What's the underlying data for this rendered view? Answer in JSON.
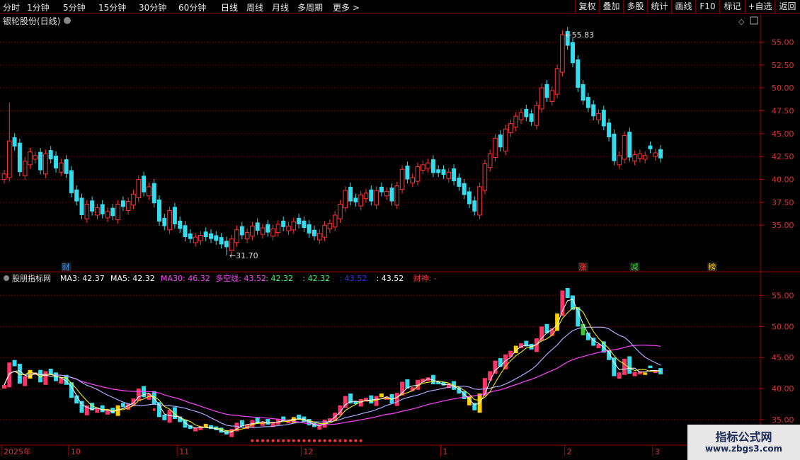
{
  "toolbar": {
    "periods": [
      "分时",
      "1分钟",
      "5分钟",
      "15分钟",
      "30分钟",
      "60分钟",
      "日线",
      "周线",
      "月线",
      "多周期"
    ],
    "more": "更多 >",
    "active": "日线",
    "right": [
      "复权",
      "叠加",
      "多股",
      "统计",
      "画线",
      "F10",
      "标记",
      "+自选",
      "返回"
    ]
  },
  "main_title": "银轮股份(日线)",
  "indicator": {
    "name": "股朋指标网",
    "labels": [
      {
        "text": "MA3: 42.37",
        "color": "#ffffff"
      },
      {
        "text": "MA5: 42.32",
        "color": "#ffffff"
      },
      {
        "text": "MA30: 46.32",
        "color": "#ff44ff"
      },
      {
        "text": "多空线: 43.52",
        "color": "#ff44ff"
      },
      {
        "text": ": 42.32",
        "color": "#33ff66"
      },
      {
        "text": ": 42.32",
        "color": "#33ff66"
      },
      {
        "text": ": 43.52",
        "color": "#3333ff"
      },
      {
        "text": ": 43.52",
        "color": "#ffffff"
      },
      {
        "text": "财神: -",
        "color": "#ff3333"
      }
    ]
  },
  "watermark": {
    "line1": "指标公式网",
    "line2": "www.zbgs3.com"
  },
  "events": [
    {
      "text": "财",
      "day": 12,
      "color": "#3399ff"
    },
    {
      "text": "涨",
      "day": 112,
      "color": "#ff3333"
    },
    {
      "text": "减",
      "day": 122,
      "color": "#33cc33"
    },
    {
      "text": "榜",
      "day": 137,
      "color": "#ffcc00"
    }
  ],
  "chart_data": {
    "type": "candlestick",
    "price_ticks": [
      35.0,
      37.5,
      40.0,
      42.5,
      45.0,
      47.5,
      50.0,
      52.5,
      55.0
    ],
    "indicator_ticks": [
      35.0,
      40.0,
      45.0,
      50.0,
      55.0
    ],
    "main_ylim": [
      31.0,
      56.5
    ],
    "ind_ylim": [
      31.0,
      57.0
    ],
    "high_label": "55.83",
    "low_label": "31.70",
    "x_ticks": [
      {
        "label": "2025年",
        "day": 0
      },
      {
        "label": "10",
        "day": 13
      },
      {
        "label": "11",
        "day": 34
      },
      {
        "label": "12",
        "day": 58
      },
      {
        "label": "1",
        "day": 85
      },
      {
        "label": "2",
        "day": 109
      },
      {
        "label": "3",
        "day": 126
      }
    ],
    "closes": [
      40.6,
      44.2,
      43.6,
      40.8,
      42.0,
      43.0,
      42.6,
      41.0,
      42.8,
      42.2,
      41.2,
      41.8,
      40.6,
      38.5,
      37.6,
      36.1,
      37.3,
      36.5,
      36.9,
      36.2,
      36.5,
      36.0,
      37.3,
      37.0,
      37.6,
      38.4,
      40.0,
      38.6,
      39.2,
      37.4,
      35.4,
      34.9,
      36.6,
      35.1,
      34.6,
      33.7,
      33.5,
      33.7,
      33.9,
      33.7,
      33.5,
      33.3,
      32.9,
      32.6,
      33.5,
      34.5,
      33.9,
      34.2,
      34.9,
      34.4,
      34.7,
      34.2,
      34.6,
      35.1,
      34.8,
      34.9,
      35.4,
      35.1,
      34.7,
      34.1,
      33.8,
      34.1,
      35.0,
      35.2,
      36.1,
      37.3,
      38.8,
      37.6,
      37.5,
      38.3,
      38.5,
      37.6,
      38.8,
      38.6,
      38.7,
      37.6,
      39.3,
      41.1,
      40.0,
      40.2,
      41.4,
      41.6,
      41.8,
      40.7,
      40.7,
      40.5,
      40.8,
      39.8,
      39.2,
      38.3,
      37.3,
      36.5,
      39.2,
      41.7,
      42.8,
      44.5,
      43.5,
      45.5,
      46.1,
      46.9,
      47.3,
      46.8,
      46.3,
      48.1,
      50.0,
      48.9,
      49.7,
      52.1,
      55.8,
      54.6,
      52.7,
      50.0,
      48.6,
      47.8,
      46.9,
      47.2,
      45.8,
      44.6,
      42.0,
      42.6,
      44.8,
      42.4,
      42.7,
      42.8,
      42.6,
      43.3,
      42.9,
      42.3
    ],
    "colors": [
      "r",
      "r",
      "c",
      "c",
      "r",
      "r",
      "r",
      "c",
      "r",
      "c",
      "c",
      "r",
      "c",
      "c",
      "c",
      "c",
      "r",
      "c",
      "r",
      "c",
      "r",
      "c",
      "r",
      "c",
      "r",
      "r",
      "r",
      "c",
      "r",
      "c",
      "c",
      "c",
      "r",
      "c",
      "c",
      "c",
      "c",
      "r",
      "r",
      "c",
      "c",
      "c",
      "c",
      "c",
      "r",
      "r",
      "c",
      "r",
      "r",
      "c",
      "r",
      "c",
      "r",
      "r",
      "c",
      "r",
      "r",
      "c",
      "c",
      "c",
      "c",
      "r",
      "r",
      "r",
      "r",
      "r",
      "r",
      "c",
      "c",
      "r",
      "r",
      "c",
      "r",
      "c",
      "r",
      "c",
      "r",
      "r",
      "c",
      "r",
      "r",
      "r",
      "r",
      "c",
      "c",
      "c",
      "r",
      "c",
      "c",
      "c",
      "c",
      "c",
      "r",
      "r",
      "r",
      "r",
      "c",
      "r",
      "r",
      "r",
      "r",
      "c",
      "c",
      "r",
      "r",
      "c",
      "r",
      "r",
      "r",
      "c",
      "c",
      "c",
      "c",
      "c",
      "c",
      "r",
      "c",
      "c",
      "c",
      "r",
      "r",
      "c",
      "r",
      "r",
      "r",
      "c",
      "r",
      "c"
    ],
    "series": [
      {
        "name": "MA3",
        "color": "#ffffff"
      },
      {
        "name": "MA5",
        "color": "#ffff00"
      },
      {
        "name": "MA30",
        "color": "#ff44ff"
      },
      {
        "name": "多空线",
        "color": "#aaaaff"
      }
    ]
  }
}
